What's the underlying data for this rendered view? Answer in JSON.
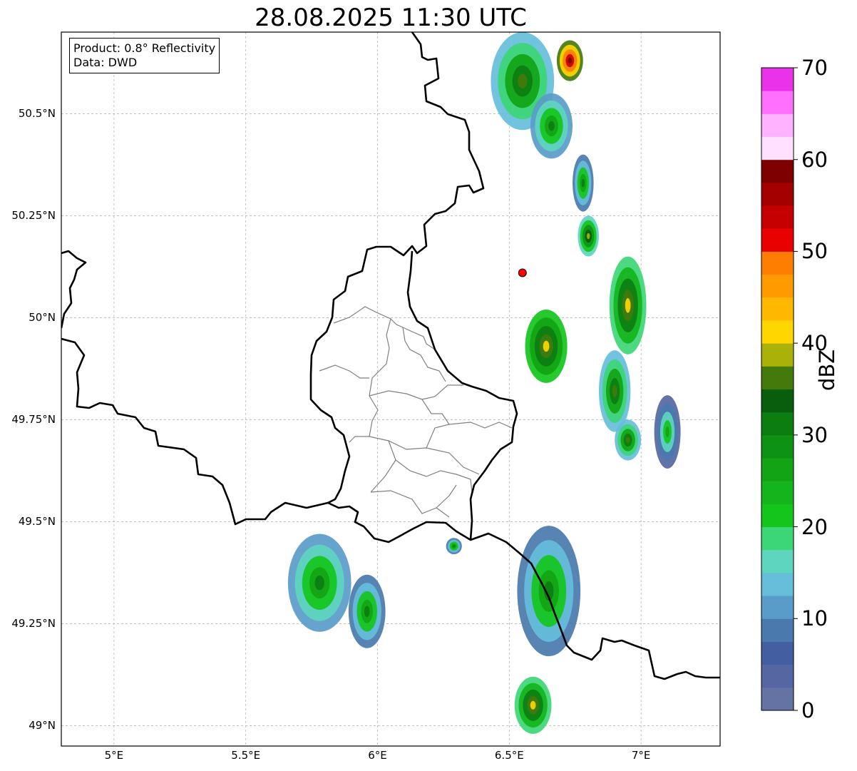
{
  "title": "28.08.2025 11:30 UTC",
  "info_box": {
    "product": "Product: 0.8° Reflectivity",
    "data": "Data: DWD"
  },
  "map": {
    "lon_range": [
      4.8,
      7.3
    ],
    "lat_range": [
      48.95,
      50.7
    ],
    "lat_ticks": [
      {
        "value": 50.5,
        "label": "50.5°N"
      },
      {
        "value": 50.25,
        "label": "50.25°N"
      },
      {
        "value": 50.0,
        "label": "50°N"
      },
      {
        "value": 49.75,
        "label": "49.75°N"
      },
      {
        "value": 49.5,
        "label": "49.5°N"
      },
      {
        "value": 49.25,
        "label": "49.25°N"
      },
      {
        "value": 49.0,
        "label": "49°N"
      }
    ],
    "lon_ticks": [
      {
        "value": 5.0,
        "label": "5°E"
      },
      {
        "value": 5.5,
        "label": "5.5°E"
      },
      {
        "value": 6.0,
        "label": "6°E"
      },
      {
        "value": 6.5,
        "label": "6.5°E"
      },
      {
        "value": 7.0,
        "label": "7°E"
      }
    ],
    "grid": true,
    "radar_site": {
      "lon": 6.55,
      "lat": 50.11,
      "color": "#ff0000"
    },
    "echo_cells": [
      {
        "lon": 6.55,
        "lat": 50.58,
        "rlon": 0.12,
        "rlat": 0.12,
        "dbz": 25
      },
      {
        "lon": 6.66,
        "lat": 50.47,
        "rlon": 0.08,
        "rlat": 0.08,
        "dbz": 22
      },
      {
        "lon": 6.73,
        "lat": 50.63,
        "rlon": 0.05,
        "rlat": 0.05,
        "dbz": 48
      },
      {
        "lon": 6.78,
        "lat": 50.33,
        "rlon": 0.04,
        "rlat": 0.07,
        "dbz": 20
      },
      {
        "lon": 6.8,
        "lat": 50.2,
        "rlon": 0.04,
        "rlat": 0.05,
        "dbz": 28
      },
      {
        "lon": 6.95,
        "lat": 50.03,
        "rlon": 0.07,
        "rlat": 0.12,
        "dbz": 30
      },
      {
        "lon": 6.64,
        "lat": 49.93,
        "rlon": 0.08,
        "rlat": 0.09,
        "dbz": 32
      },
      {
        "lon": 6.9,
        "lat": 49.82,
        "rlon": 0.06,
        "rlat": 0.1,
        "dbz": 25
      },
      {
        "lon": 6.95,
        "lat": 49.7,
        "rlon": 0.05,
        "rlat": 0.05,
        "dbz": 25
      },
      {
        "lon": 7.1,
        "lat": 49.72,
        "rlon": 0.05,
        "rlat": 0.09,
        "dbz": 15
      },
      {
        "lon": 5.78,
        "lat": 49.35,
        "rlon": 0.12,
        "rlat": 0.12,
        "dbz": 22
      },
      {
        "lon": 5.96,
        "lat": 49.28,
        "rlon": 0.07,
        "rlat": 0.09,
        "dbz": 20
      },
      {
        "lon": 6.65,
        "lat": 49.33,
        "rlon": 0.12,
        "rlat": 0.16,
        "dbz": 20
      },
      {
        "lon": 6.59,
        "lat": 49.05,
        "rlon": 0.07,
        "rlat": 0.07,
        "dbz": 30
      },
      {
        "lon": 6.29,
        "lat": 49.44,
        "rlon": 0.03,
        "rlat": 0.02,
        "dbz": 20
      }
    ]
  },
  "colorbar": {
    "label": "dBZ",
    "min": 0,
    "max": 70,
    "tick_labels": [
      "0",
      "10",
      "20",
      "30",
      "40",
      "50",
      "60",
      "70"
    ],
    "colors": [
      "#6473a4",
      "#5567a2",
      "#445ea2",
      "#4a79ae",
      "#5a9cc9",
      "#66bedb",
      "#5dd5bf",
      "#3dd676",
      "#14c51c",
      "#14b41c",
      "#12a414",
      "#0e9213",
      "#0c7e11",
      "#085e0c",
      "#447a0c",
      "#aab109",
      "#ffd600",
      "#ffb800",
      "#ff9b00",
      "#ff7d00",
      "#e90000",
      "#c60000",
      "#a40000",
      "#7e0000",
      "#ffe0ff",
      "#ffb2ff",
      "#ff70ff",
      "#ea32ea"
    ]
  }
}
